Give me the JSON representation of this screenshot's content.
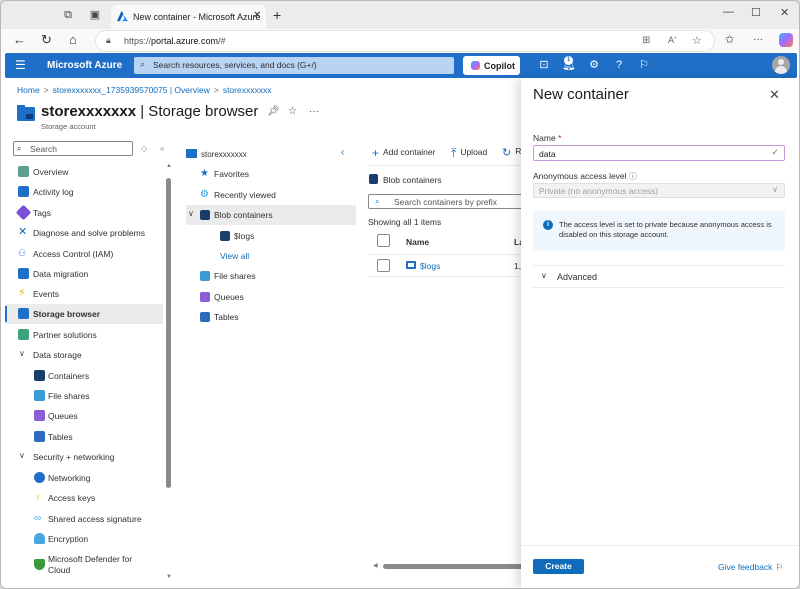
{
  "browser": {
    "tab_title": "New container - Microsoft Azure",
    "url_prefix": "https://",
    "url_host": "portal.azure.com",
    "url_rest": "/#",
    "icons": [
      "workspaces-icon",
      "tab-actions-icon",
      "back-icon",
      "refresh-icon",
      "home-icon",
      "lock-icon",
      "split-screen-icon",
      "read-aloud-icon",
      "favorite-icon",
      "favorites-bar-icon",
      "more-icon",
      "copilot-icon"
    ]
  },
  "azure": {
    "brand": "Microsoft Azure",
    "search_placeholder": "Search resources, services, and docs (G+/)",
    "copilot_label": "Copilot",
    "notification_count": "1"
  },
  "breadcrumb": [
    "Home",
    "storexxxxxxx_1735939570075 | Overview",
    "storexxxxxxx"
  ],
  "page": {
    "title_bold": "storexxxxxxx",
    "title_rest": " | Storage browser",
    "subtitle": "Storage account",
    "more": "···"
  },
  "leftnav": {
    "search_placeholder": "Search",
    "items": [
      {
        "label": "Overview",
        "color": "#5e9e8f"
      },
      {
        "label": "Activity log",
        "color": "#1f6fc8"
      },
      {
        "label": "Tags",
        "color": "#7a4fd6"
      },
      {
        "label": "Diagnose and solve problems",
        "color": "#0f6cbd"
      },
      {
        "label": "Access Control (IAM)",
        "color": "#3b8fd8"
      },
      {
        "label": "Data migration",
        "color": "#1f6fc8"
      },
      {
        "label": "Events",
        "color": "#f2b600"
      },
      {
        "label": "Storage browser",
        "color": "#1f6fc8",
        "selected": true
      },
      {
        "label": "Partner solutions",
        "color": "#3aa37a"
      }
    ],
    "groups": [
      {
        "label": "Data storage",
        "items": [
          {
            "label": "Containers",
            "color": "#1a3e6a"
          },
          {
            "label": "File shares",
            "color": "#3b9ad8"
          },
          {
            "label": "Queues",
            "color": "#8a5cd6"
          },
          {
            "label": "Tables",
            "color": "#2c6bbd"
          }
        ]
      },
      {
        "label": "Security + networking",
        "items": [
          {
            "label": "Networking",
            "color": "#1f6fc8"
          },
          {
            "label": "Access keys",
            "color": "#f2b600"
          },
          {
            "label": "Shared access signature",
            "color": "#4aa6e0"
          },
          {
            "label": "Encryption",
            "color": "#4aa6e0"
          },
          {
            "label": "Microsoft Defender for",
            "label2": "Cloud",
            "color": "#3a9a3a"
          }
        ]
      }
    ]
  },
  "tree": {
    "root": "storexxxxxxx",
    "items": [
      {
        "label": "Favorites",
        "color": "#1f6fc8"
      },
      {
        "label": "Recently viewed",
        "color": "#2b9ad8"
      },
      {
        "label": "Blob containers",
        "color": "#1a3e6a"
      },
      {
        "label": "$logs",
        "color": "#1a3e6a"
      },
      {
        "label": "View all"
      },
      {
        "label": "File shares",
        "color": "#3b9ad8"
      },
      {
        "label": "Queues",
        "color": "#8a5cd6"
      },
      {
        "label": "Tables",
        "color": "#2c6bbd"
      }
    ]
  },
  "main": {
    "toolbar": {
      "add": "Add container",
      "upload": "Upload",
      "refresh": "R"
    },
    "section": "Blob containers",
    "search_placeholder": "Search containers by prefix",
    "count_text": "Showing all 1 items",
    "columns": [
      "Name",
      "La"
    ],
    "rows": [
      {
        "name": "$logs",
        "col2": "1,"
      }
    ]
  },
  "panel": {
    "title": "New container",
    "name_label": "Name",
    "required_mark": "*",
    "name_value": "data",
    "access_label": "Anonymous access level",
    "access_value": "Private (no anonymous access)",
    "info_text": "The access level is set to private because anonymous access is disabled on this storage account.",
    "advanced_label": "Advanced",
    "create_label": "Create",
    "feedback_label": "Give feedback"
  }
}
